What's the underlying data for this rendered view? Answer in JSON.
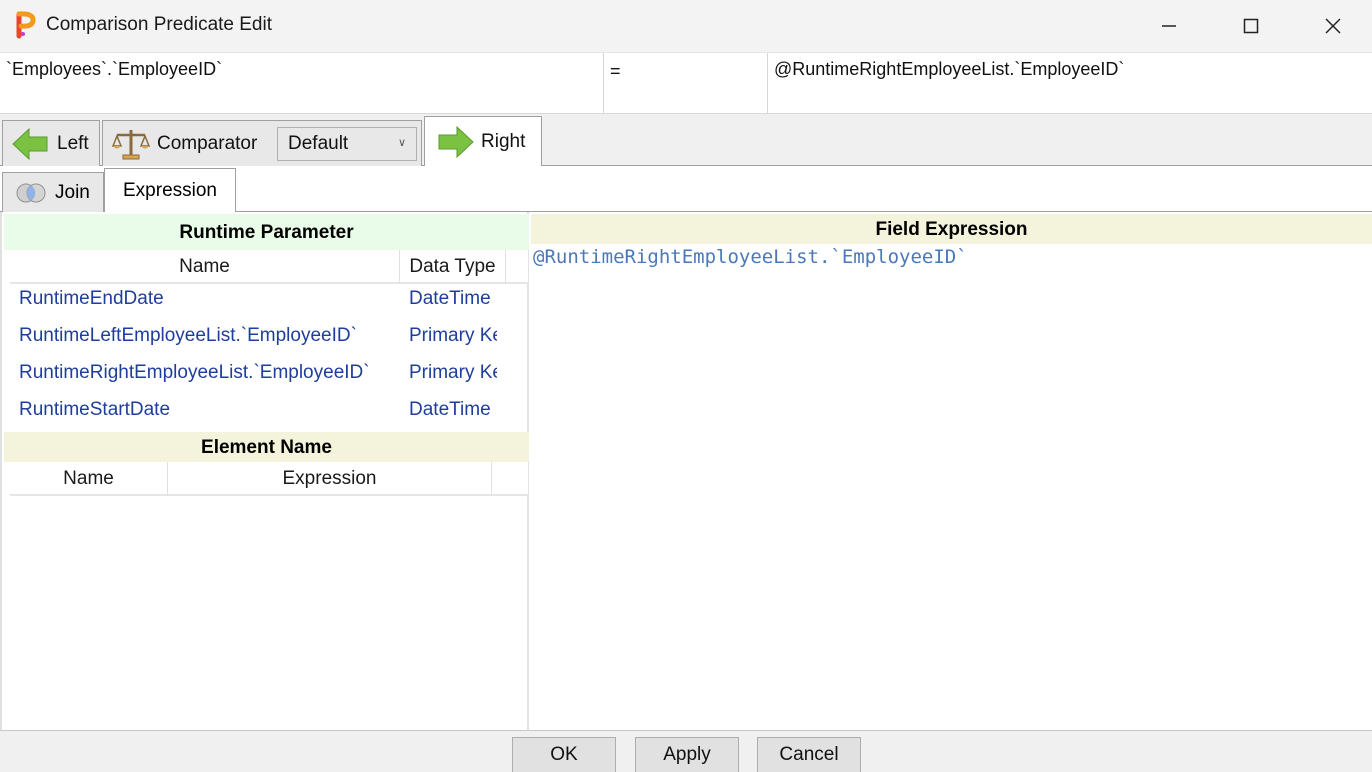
{
  "window": {
    "title": "Comparison Predicate Edit"
  },
  "predicate": {
    "left": "`Employees`.`EmployeeID`",
    "operator": "=",
    "right": "@RuntimeRightEmployeeList.`EmployeeID`"
  },
  "main_tabs": {
    "left_label": "Left",
    "comparator_label": "Comparator",
    "comparator_value": "Default",
    "right_label": "Right"
  },
  "sub_tabs": {
    "join_label": "Join",
    "expression_label": "Expression"
  },
  "runtime_parameter": {
    "header": "Runtime Parameter",
    "columns": [
      "Name",
      "Data Type"
    ],
    "rows": [
      {
        "name": "RuntimeEndDate",
        "type": "DateTime"
      },
      {
        "name": "RuntimeLeftEmployeeList.`EmployeeID`",
        "type": "Primary Key"
      },
      {
        "name": "RuntimeRightEmployeeList.`EmployeeID`",
        "type": "Primary Key"
      },
      {
        "name": "RuntimeStartDate",
        "type": "DateTime"
      }
    ]
  },
  "element_name": {
    "header": "Element Name",
    "columns": [
      "Name",
      "Expression"
    ]
  },
  "field_expression": {
    "header": "Field Expression",
    "value": "@RuntimeRightEmployeeList.`EmployeeID`"
  },
  "footer": {
    "ok": "OK",
    "apply": "Apply",
    "cancel": "Cancel"
  },
  "colors": {
    "link_text": "#1f3d9b",
    "expression_text": "#4a78b8",
    "runtime_header_bg": "#e9fbe9",
    "section_header_bg": "#f4f4dc"
  }
}
